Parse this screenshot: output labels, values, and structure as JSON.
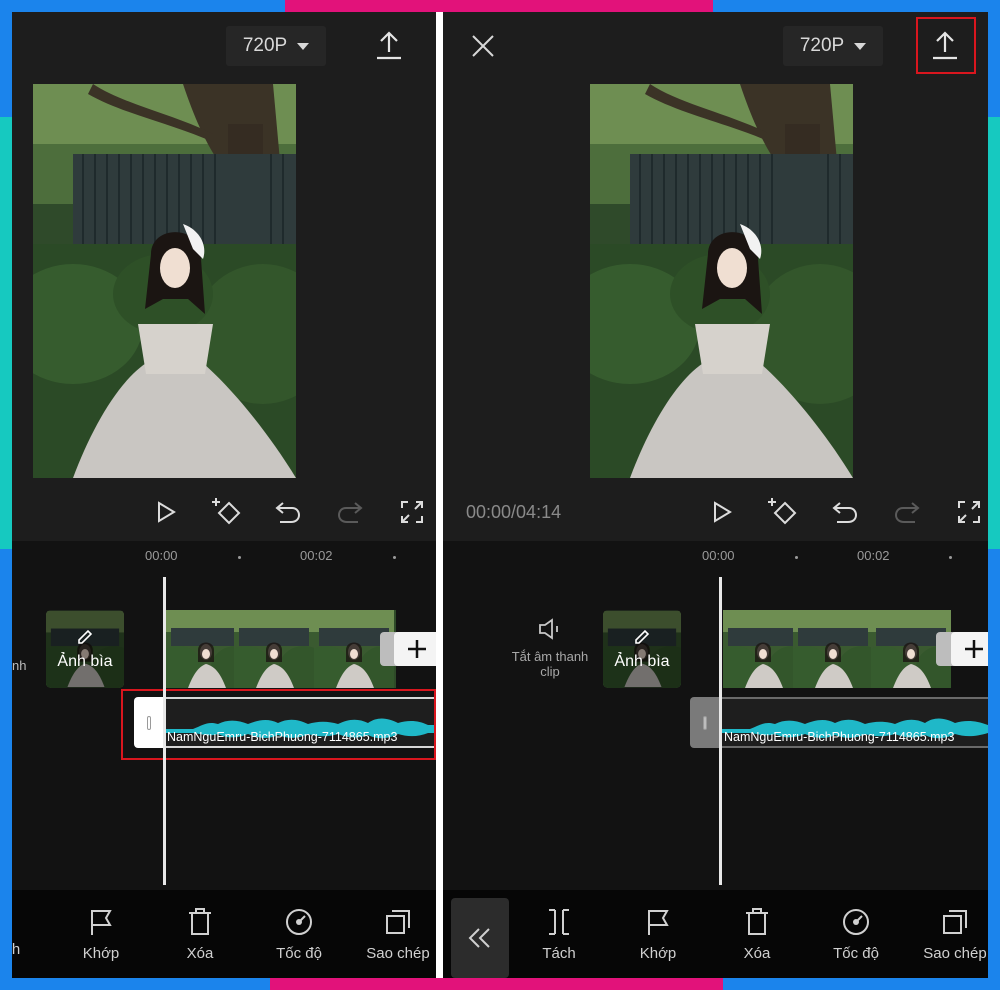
{
  "colors": {
    "frame_blue": "#1b84ec",
    "frame_pink": "#e2127a",
    "frame_teal": "#16c9c0",
    "highlight_red": "#d9161e",
    "waveform": "#1fb8c8"
  },
  "left": {
    "resolution": "720P",
    "ruler": [
      "00:00",
      "00:02"
    ],
    "cover_label": "Ảnh bìa",
    "edge_label": "nh",
    "audio_filename": "NamNguEmru-BichPhuong-7114865.mp3",
    "tools": [
      {
        "label": "h",
        "icon": "edge-icon"
      },
      {
        "label": "Khớp",
        "icon": "flag-icon"
      },
      {
        "label": "Xóa",
        "icon": "trash-icon"
      },
      {
        "label": "Tốc độ",
        "icon": "speed-icon"
      },
      {
        "label": "Sao chép",
        "icon": "copy-icon"
      }
    ]
  },
  "right": {
    "resolution": "720P",
    "time": "00:00/04:14",
    "ruler": [
      "00:00",
      "00:02"
    ],
    "mute_label": "Tắt âm thanh clip",
    "cover_label": "Ảnh bìa",
    "audio_filename": "NamNguEmru-BichPhuong-7114865.mp3",
    "tools": [
      {
        "label": "Tách",
        "icon": "split-icon"
      },
      {
        "label": "Khớp",
        "icon": "flag-icon"
      },
      {
        "label": "Xóa",
        "icon": "trash-icon"
      },
      {
        "label": "Tốc độ",
        "icon": "speed-icon"
      },
      {
        "label": "Sao chép",
        "icon": "copy-icon"
      }
    ]
  }
}
